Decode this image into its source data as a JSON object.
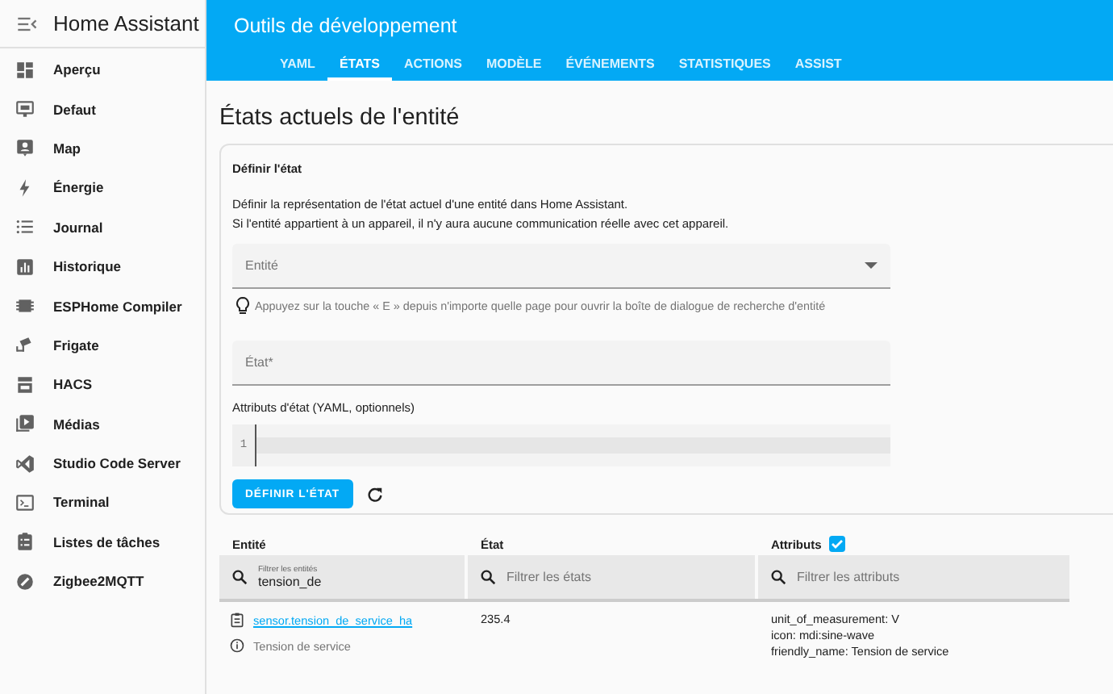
{
  "sidebar": {
    "title": "Home Assistant",
    "items": [
      {
        "label": "Aperçu"
      },
      {
        "label": "Defaut"
      },
      {
        "label": "Map"
      },
      {
        "label": "Énergie"
      },
      {
        "label": "Journal"
      },
      {
        "label": "Historique"
      },
      {
        "label": "ESPHome Compiler"
      },
      {
        "label": "Frigate"
      },
      {
        "label": "HACS"
      },
      {
        "label": "Médias"
      },
      {
        "label": "Studio Code Server"
      },
      {
        "label": "Terminal"
      },
      {
        "label": "Listes de tâches"
      },
      {
        "label": "Zigbee2MQTT"
      }
    ]
  },
  "header": {
    "title": "Outils de développement",
    "tabs": [
      {
        "label": "YAML",
        "selected": false
      },
      {
        "label": "ÉTATS",
        "selected": true
      },
      {
        "label": "ACTIONS",
        "selected": false
      },
      {
        "label": "MODÈLE",
        "selected": false
      },
      {
        "label": "ÉVÉNEMENTS",
        "selected": false
      },
      {
        "label": "STATISTIQUES",
        "selected": false
      },
      {
        "label": "ASSIST",
        "selected": false
      }
    ]
  },
  "page_title": "États actuels de l'entité",
  "set_state": {
    "title": "Définir l'état",
    "description": [
      "Définir la représentation de l'état actuel d'une entité dans Home Assistant.",
      "Si l'entité appartient à un appareil, il n'y aura aucune communication réelle avec cet appareil."
    ],
    "entity_field": {
      "label": "Entité"
    },
    "hint": "Appuyez sur la touche « E » depuis n'importe quelle page pour ouvrir la boîte de dialogue de recherche d'entité",
    "state_field": {
      "label": "État*"
    },
    "attributes_label": "Attributs d'état (YAML, optionnels)",
    "editor": {
      "line_numbers": [
        "1"
      ]
    },
    "button": "DÉFINIR L'ÉTAT"
  },
  "table": {
    "columns": [
      {
        "label": "Entité"
      },
      {
        "label": "État"
      },
      {
        "label": "Attributs",
        "checked": true
      }
    ],
    "filters": [
      {
        "label": "Filtrer les entités",
        "value": "tension_de"
      },
      {
        "placeholder": "Filtrer les états"
      },
      {
        "placeholder": "Filtrer les attributs"
      }
    ],
    "rows": [
      {
        "entity_id": "sensor.tension_de_service_ha",
        "friendly_name": "Tension de service",
        "state": "235.4",
        "attributes": [
          "unit_of_measurement: V",
          "icon: mdi:sine-wave",
          "friendly_name: Tension de service"
        ]
      }
    ]
  }
}
